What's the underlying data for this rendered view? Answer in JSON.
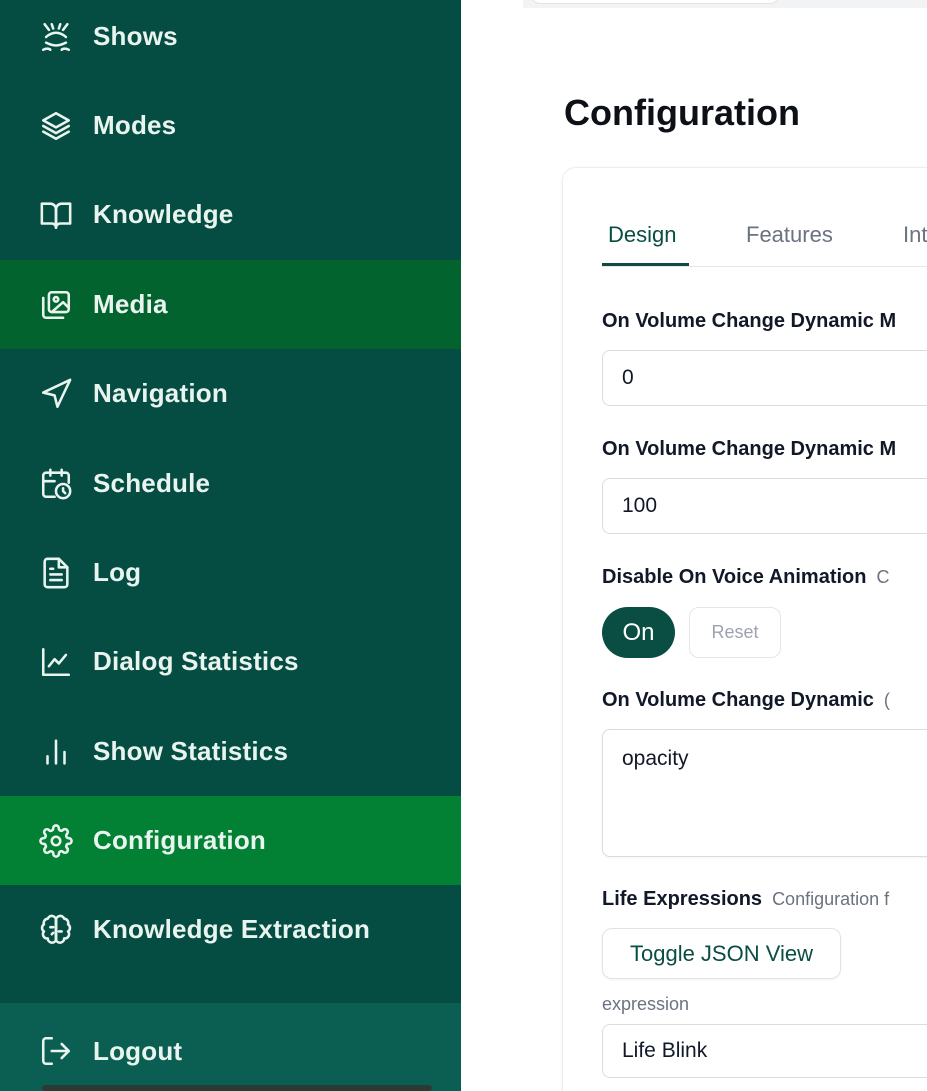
{
  "sidebar": {
    "items": [
      {
        "label": "Shows",
        "icon": "shows-icon"
      },
      {
        "label": "Modes",
        "icon": "layers-icon"
      },
      {
        "label": "Knowledge",
        "icon": "book-icon"
      },
      {
        "label": "Media",
        "icon": "image-gallery-icon"
      },
      {
        "label": "Navigation",
        "icon": "navigation-arrow-icon"
      },
      {
        "label": "Schedule",
        "icon": "calendar-clock-icon"
      },
      {
        "label": "Log",
        "icon": "document-icon"
      },
      {
        "label": "Dialog Statistics",
        "icon": "line-chart-icon"
      },
      {
        "label": "Show Statistics",
        "icon": "bar-chart-icon"
      },
      {
        "label": "Configuration",
        "icon": "gear-icon"
      },
      {
        "label": "Knowledge Extraction",
        "icon": "brain-icon"
      }
    ],
    "logout_label": "Logout"
  },
  "main": {
    "title": "Configuration",
    "tabs": [
      {
        "label": "Design"
      },
      {
        "label": "Features"
      },
      {
        "label": "Int"
      }
    ],
    "fields": {
      "min_label": "On Volume Change Dynamic M",
      "min_value": "0",
      "max_label": "On Volume Change Dynamic M",
      "max_value": "100",
      "voice_anim_label": "Disable On Voice Animation",
      "voice_anim_hint": "C",
      "toggle_label": "On",
      "reset_label": "Reset",
      "dynamic_label": "On Volume Change Dynamic",
      "dynamic_hint": "(",
      "dynamic_value": "opacity",
      "life_label": "Life Expressions",
      "life_hint": "Configuration f",
      "json_button_label": "Toggle JSON View",
      "expression_label": "expression",
      "expression_value": "Life Blink"
    }
  },
  "colors": {
    "sidebar_bg": "#054d42",
    "media_active_bg": "#03632f",
    "config_active_bg": "#028033",
    "accent": "#0a4d42"
  }
}
